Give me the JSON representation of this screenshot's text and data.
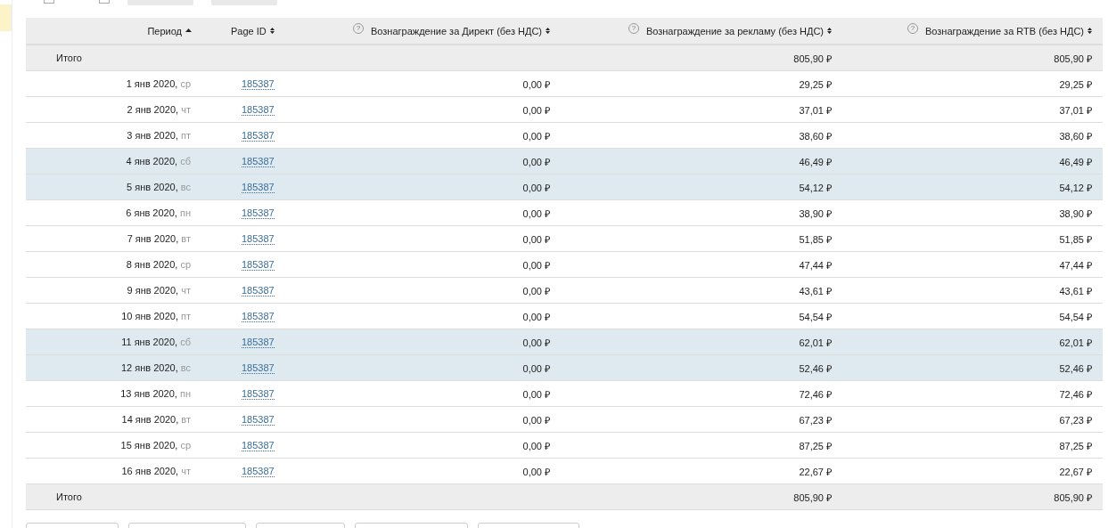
{
  "checkboxes": [
    {
      "checked": false
    },
    {
      "checked": false
    }
  ],
  "columns": [
    {
      "label": "Период",
      "sorted": true
    },
    {
      "label": "Page ID",
      "sorted": false
    },
    {
      "label": "Вознаграждение за Директ (без НДС)",
      "sorted": false,
      "help": "?"
    },
    {
      "label": "Вознаграждение за рекламу (без НДС)",
      "sorted": false,
      "help": "?"
    },
    {
      "label": "Вознаграждение за RTB (без НДС)",
      "sorted": false,
      "help": "?"
    }
  ],
  "total_top": {
    "label": "Итого",
    "ads": "805,90 ₽",
    "rtb": "805,90 ₽"
  },
  "rows": [
    {
      "date": "1 янв 2020,",
      "weekday": "ср",
      "page_id": "185387",
      "direct": "0,00 ₽",
      "ads": "29,25 ₽",
      "rtb": "29,25 ₽",
      "weekend": false
    },
    {
      "date": "2 янв 2020,",
      "weekday": "чт",
      "page_id": "185387",
      "direct": "0,00 ₽",
      "ads": "37,01 ₽",
      "rtb": "37,01 ₽",
      "weekend": false
    },
    {
      "date": "3 янв 2020,",
      "weekday": "пт",
      "page_id": "185387",
      "direct": "0,00 ₽",
      "ads": "38,60 ₽",
      "rtb": "38,60 ₽",
      "weekend": false
    },
    {
      "date": "4 янв 2020,",
      "weekday": "сб",
      "page_id": "185387",
      "direct": "0,00 ₽",
      "ads": "46,49 ₽",
      "rtb": "46,49 ₽",
      "weekend": true
    },
    {
      "date": "5 янв 2020,",
      "weekday": "вс",
      "page_id": "185387",
      "direct": "0,00 ₽",
      "ads": "54,12 ₽",
      "rtb": "54,12 ₽",
      "weekend": true
    },
    {
      "date": "6 янв 2020,",
      "weekday": "пн",
      "page_id": "185387",
      "direct": "0,00 ₽",
      "ads": "38,90 ₽",
      "rtb": "38,90 ₽",
      "weekend": false
    },
    {
      "date": "7 янв 2020,",
      "weekday": "вт",
      "page_id": "185387",
      "direct": "0,00 ₽",
      "ads": "51,85 ₽",
      "rtb": "51,85 ₽",
      "weekend": false
    },
    {
      "date": "8 янв 2020,",
      "weekday": "ср",
      "page_id": "185387",
      "direct": "0,00 ₽",
      "ads": "47,44 ₽",
      "rtb": "47,44 ₽",
      "weekend": false
    },
    {
      "date": "9 янв 2020,",
      "weekday": "чт",
      "page_id": "185387",
      "direct": "0,00 ₽",
      "ads": "43,61 ₽",
      "rtb": "43,61 ₽",
      "weekend": false
    },
    {
      "date": "10 янв 2020,",
      "weekday": "пт",
      "page_id": "185387",
      "direct": "0,00 ₽",
      "ads": "54,54 ₽",
      "rtb": "54,54 ₽",
      "weekend": false
    },
    {
      "date": "11 янв 2020,",
      "weekday": "сб",
      "page_id": "185387",
      "direct": "0,00 ₽",
      "ads": "62,01 ₽",
      "rtb": "62,01 ₽",
      "weekend": true
    },
    {
      "date": "12 янв 2020,",
      "weekday": "вс",
      "page_id": "185387",
      "direct": "0,00 ₽",
      "ads": "52,46 ₽",
      "rtb": "52,46 ₽",
      "weekend": true
    },
    {
      "date": "13 янв 2020,",
      "weekday": "пн",
      "page_id": "185387",
      "direct": "0,00 ₽",
      "ads": "72,46 ₽",
      "rtb": "72,46 ₽",
      "weekend": false
    },
    {
      "date": "14 янв 2020,",
      "weekday": "вт",
      "page_id": "185387",
      "direct": "0,00 ₽",
      "ads": "67,23 ₽",
      "rtb": "67,23 ₽",
      "weekend": false
    },
    {
      "date": "15 янв 2020,",
      "weekday": "ср",
      "page_id": "185387",
      "direct": "0,00 ₽",
      "ads": "87,25 ₽",
      "rtb": "87,25 ₽",
      "weekend": false
    },
    {
      "date": "16 янв 2020,",
      "weekday": "чт",
      "page_id": "185387",
      "direct": "0,00 ₽",
      "ads": "22,67 ₽",
      "rtb": "22,67 ₽",
      "weekend": false
    }
  ],
  "total_bottom": {
    "label": "Итого",
    "ads": "805,90 ₽",
    "rtb": "805,90 ₽"
  }
}
